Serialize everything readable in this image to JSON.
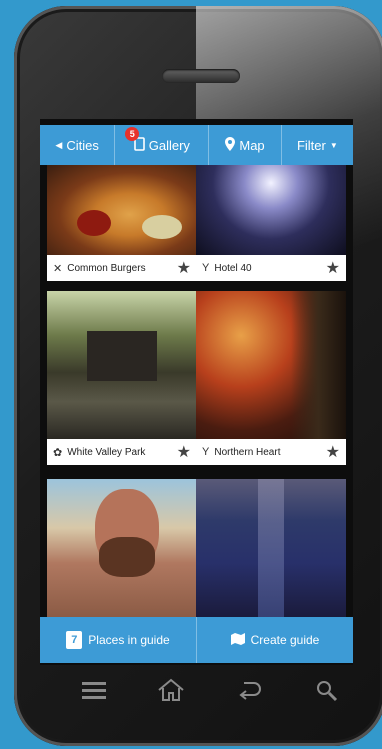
{
  "nav": {
    "cities_label": "Cities",
    "gallery_label": "Gallery",
    "gallery_badge": "5",
    "map_label": "Map",
    "filter_label": "Filter"
  },
  "places": [
    {
      "name": "Common Burgers",
      "icon": "fork-knife-icon"
    },
    {
      "name": "Hotel 40",
      "icon": "cocktail-icon"
    },
    {
      "name": "White Valley Park",
      "icon": "leaf-icon"
    },
    {
      "name": "Northern Heart",
      "icon": "cocktail-icon"
    }
  ],
  "bottom": {
    "places_count": "7",
    "places_label": "Places in guide",
    "create_label": "Create guide"
  },
  "colors": {
    "accent": "#3d9bd6",
    "background": "#3399cc",
    "badge": "#e8322c"
  }
}
